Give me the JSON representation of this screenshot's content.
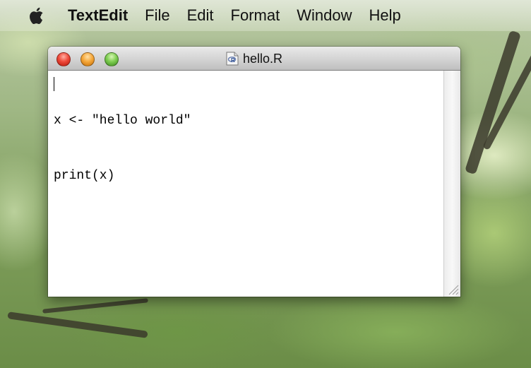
{
  "menubar": {
    "apple_icon": "apple-icon",
    "items": [
      {
        "label": "TextEdit"
      },
      {
        "label": "File"
      },
      {
        "label": "Edit"
      },
      {
        "label": "Format"
      },
      {
        "label": "Window"
      },
      {
        "label": "Help"
      }
    ]
  },
  "window": {
    "title": "hello.R",
    "title_icon": "r-document-icon",
    "lines": [
      "x <- \"hello world\"",
      "print(x)"
    ]
  },
  "colors": {
    "close": "#ef4a3b",
    "minimize": "#f6a93c",
    "zoom": "#7fce52"
  }
}
